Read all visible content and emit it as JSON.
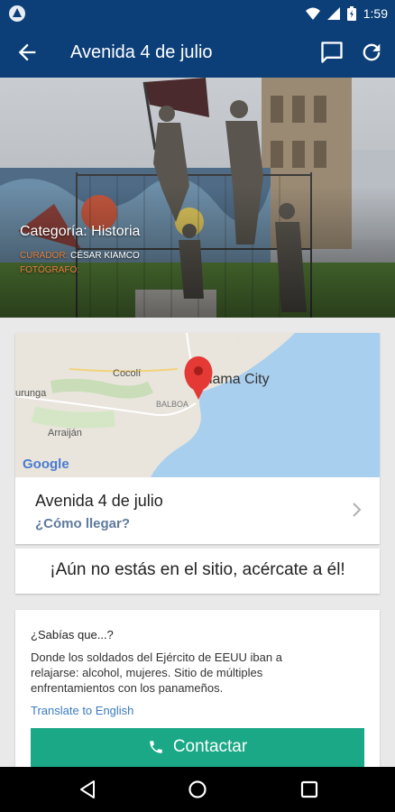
{
  "status_bar": {
    "time": "1:59"
  },
  "app_bar": {
    "title": "Avenida 4 de julio"
  },
  "hero": {
    "category": "Categoría: Historia",
    "curator_label": "CURADOR:",
    "curator_name": "CÉSAR KIAMCO",
    "photographer_label": "FOTÓGRAFO:"
  },
  "map": {
    "city_label": "Panama City",
    "place_labels": [
      "Cocolí",
      "Arraiján",
      "urunga",
      "BALBOA"
    ],
    "brand": "Google"
  },
  "location": {
    "name": "Avenida 4 de julio",
    "directions_link": "¿Cómo llegar?"
  },
  "notice": {
    "text": "¡Aún no estás en el sitio, acércate a él!"
  },
  "info": {
    "question": "¿Sabías que...?",
    "body": "Donde los soldados del Ejército de EEUU iban a relajarse: alcohol, mujeres. Sitio de múltiples enfrentamientos con los panameños.",
    "translate_link": "Translate to English",
    "contact_label": "Contactar"
  },
  "colors": {
    "app_bar": "#0c3f78",
    "accent_orange": "#e8823a",
    "contact_button": "#1aa886",
    "link": "#3b7bc0"
  },
  "icons": [
    "back-arrow-icon",
    "comment-icon",
    "refresh-icon",
    "chevron-right-icon",
    "phone-icon",
    "map-pin-icon",
    "wifi-icon",
    "signal-icon",
    "battery-icon",
    "nav-back-icon",
    "nav-home-icon",
    "nav-recents-icon"
  ]
}
